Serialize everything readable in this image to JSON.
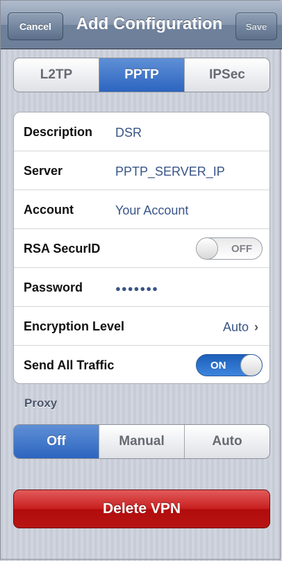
{
  "navbar": {
    "cancel_label": "Cancel",
    "title": "Add Configuration",
    "save_label": "Save"
  },
  "vpn_type": {
    "options": [
      "L2TP",
      "PPTP",
      "IPSec"
    ],
    "selected": "PPTP"
  },
  "fields": {
    "description": {
      "label": "Description",
      "value": "DSR"
    },
    "server": {
      "label": "Server",
      "value": "PPTP_SERVER_IP"
    },
    "account": {
      "label": "Account",
      "value": "Your Account"
    },
    "rsa_securid": {
      "label": "RSA SecurID",
      "state": "OFF"
    },
    "password": {
      "label": "Password",
      "value": "●●●●●●●"
    },
    "encryption_level": {
      "label": "Encryption Level",
      "value": "Auto",
      "chevron": "›"
    },
    "send_all_traffic": {
      "label": "Send All Traffic",
      "state": "ON"
    }
  },
  "proxy": {
    "section_label": "Proxy",
    "options": [
      "Off",
      "Manual",
      "Auto"
    ],
    "selected": "Off"
  },
  "delete_label": "Delete VPN",
  "colors": {
    "active_segment": "#2c65c0",
    "value_text": "#385487",
    "delete_button": "#c81f1f",
    "switch_on": "#1c5fb8"
  }
}
